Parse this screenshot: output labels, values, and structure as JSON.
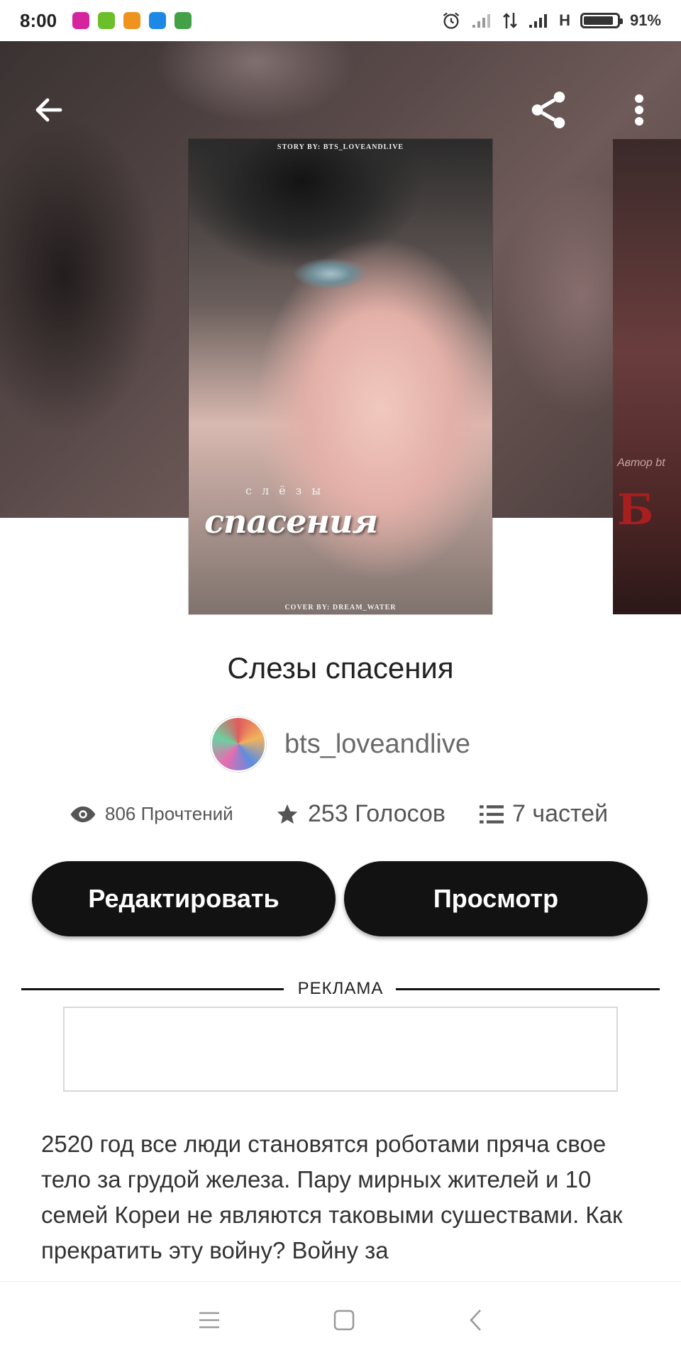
{
  "status_bar": {
    "time": "8:00",
    "battery": "91%",
    "network_label": "H",
    "notification_apps": [
      {
        "icon": "instagram-icon",
        "color": "#d6249f"
      },
      {
        "icon": "download-icon",
        "color": "#6bbf2a"
      },
      {
        "icon": "brush-icon",
        "color": "#f0931e"
      },
      {
        "icon": "upload-icon",
        "color": "#1e88e5"
      },
      {
        "icon": "android-icon",
        "color": "#43a047"
      }
    ]
  },
  "hero": {
    "icons": {
      "back": "arrow-left-icon",
      "share": "share-icon",
      "more": "more-vertical-icon"
    }
  },
  "cover": {
    "credit_top": "STORY BY: BTS_LOVEANDLIVE",
    "subtitle": "слёзы",
    "title": "спасения",
    "credit_bottom": "COVER BY: DREAM_WATER"
  },
  "next_cover": {
    "author_line": "Автор bt",
    "title_fragment": "Б"
  },
  "story": {
    "title": "Слезы спасения",
    "author": "bts_loveandlive"
  },
  "stats": {
    "reads": "806 Прочтений",
    "votes": "253 Голосов",
    "parts": "7 частей"
  },
  "actions": {
    "edit_label": "Редактировать",
    "view_label": "Просмотр"
  },
  "ad": {
    "label": "РЕКЛАМА"
  },
  "description": "2520 год все люди становятся роботами пряча свое тело за грудой железа. Пару мирных жителей и 10 семей Кореи не являются таковыми сушествами. Как прекратить эту войну? Войну за",
  "colors": {
    "button_bg": "#121212",
    "button_text": "#ffffff"
  }
}
